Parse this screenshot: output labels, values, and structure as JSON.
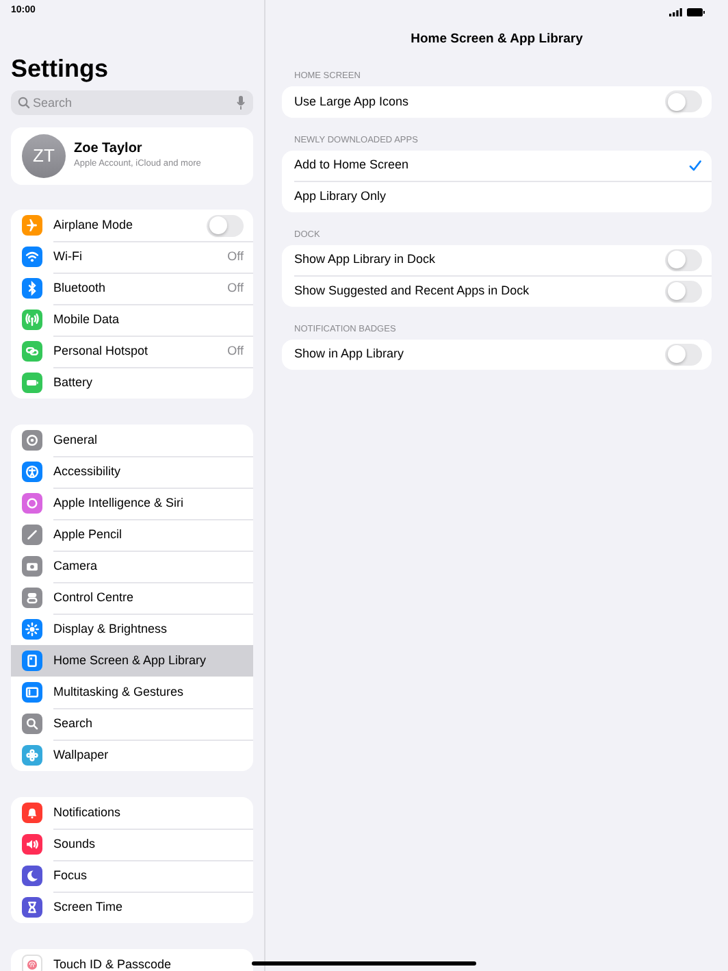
{
  "status_bar": {
    "time": "10:00"
  },
  "sidebar": {
    "title": "Settings",
    "search": {
      "placeholder": "Search"
    },
    "profile": {
      "initials": "ZT",
      "name": "Zoe Taylor",
      "subtitle": "Apple Account, iCloud and more"
    },
    "groups": [
      [
        {
          "label": "Airplane Mode",
          "kind": "toggle",
          "on": false,
          "selected": false,
          "color": "#ff9500"
        },
        {
          "label": "Wi-Fi",
          "kind": "value",
          "value": "Off",
          "selected": false,
          "color": "#0a84ff"
        },
        {
          "label": "Bluetooth",
          "kind": "value",
          "value": "Off",
          "selected": false,
          "color": "#0a84ff"
        },
        {
          "label": "Mobile Data",
          "kind": "link",
          "selected": false,
          "color": "#34c759"
        },
        {
          "label": "Personal Hotspot",
          "kind": "value",
          "value": "Off",
          "selected": false,
          "color": "#34c759"
        },
        {
          "label": "Battery",
          "kind": "link",
          "selected": false,
          "color": "#34c759"
        }
      ],
      [
        {
          "label": "General",
          "kind": "link",
          "selected": false,
          "color": "#8e8e93"
        },
        {
          "label": "Accessibility",
          "kind": "link",
          "selected": false,
          "color": "#0a84ff"
        },
        {
          "label": "Apple Intelligence & Siri",
          "kind": "link",
          "selected": false,
          "color": "#d966e0"
        },
        {
          "label": "Apple Pencil",
          "kind": "link",
          "selected": false,
          "color": "#8e8e93"
        },
        {
          "label": "Camera",
          "kind": "link",
          "selected": false,
          "color": "#8e8e93"
        },
        {
          "label": "Control Centre",
          "kind": "link",
          "selected": false,
          "color": "#8e8e93"
        },
        {
          "label": "Display & Brightness",
          "kind": "link",
          "selected": false,
          "color": "#0a84ff"
        },
        {
          "label": "Home Screen & App Library",
          "kind": "link",
          "selected": true,
          "color": "#0a84ff"
        },
        {
          "label": "Multitasking & Gestures",
          "kind": "link",
          "selected": false,
          "color": "#0a84ff"
        },
        {
          "label": "Search",
          "kind": "link",
          "selected": false,
          "color": "#8e8e93"
        },
        {
          "label": "Wallpaper",
          "kind": "link",
          "selected": false,
          "color": "#35aadc"
        }
      ],
      [
        {
          "label": "Notifications",
          "kind": "link",
          "selected": false,
          "color": "#ff3b30"
        },
        {
          "label": "Sounds",
          "kind": "link",
          "selected": false,
          "color": "#ff2d55"
        },
        {
          "label": "Focus",
          "kind": "link",
          "selected": false,
          "color": "#5856d6"
        },
        {
          "label": "Screen Time",
          "kind": "link",
          "selected": false,
          "color": "#5856d6"
        }
      ],
      [
        {
          "label": "Touch ID & Passcode",
          "kind": "link",
          "selected": false,
          "color": "#ffffff"
        }
      ]
    ]
  },
  "detail": {
    "title": "Home Screen & App Library",
    "sections": [
      {
        "header": "HOME SCREEN",
        "rows": [
          {
            "label": "Use Large App Icons",
            "kind": "toggle",
            "on": false
          }
        ]
      },
      {
        "header": "NEWLY DOWNLOADED APPS",
        "rows": [
          {
            "label": "Add to Home Screen",
            "kind": "check",
            "checked": true
          },
          {
            "label": "App Library Only",
            "kind": "check",
            "checked": false
          }
        ]
      },
      {
        "header": "DOCK",
        "rows": [
          {
            "label": "Show App Library in Dock",
            "kind": "toggle",
            "on": false
          },
          {
            "label": "Show Suggested and Recent Apps in Dock",
            "kind": "toggle",
            "on": false
          }
        ]
      },
      {
        "header": "NOTIFICATION BADGES",
        "rows": [
          {
            "label": "Show in App Library",
            "kind": "toggle",
            "on": false
          }
        ]
      }
    ]
  }
}
